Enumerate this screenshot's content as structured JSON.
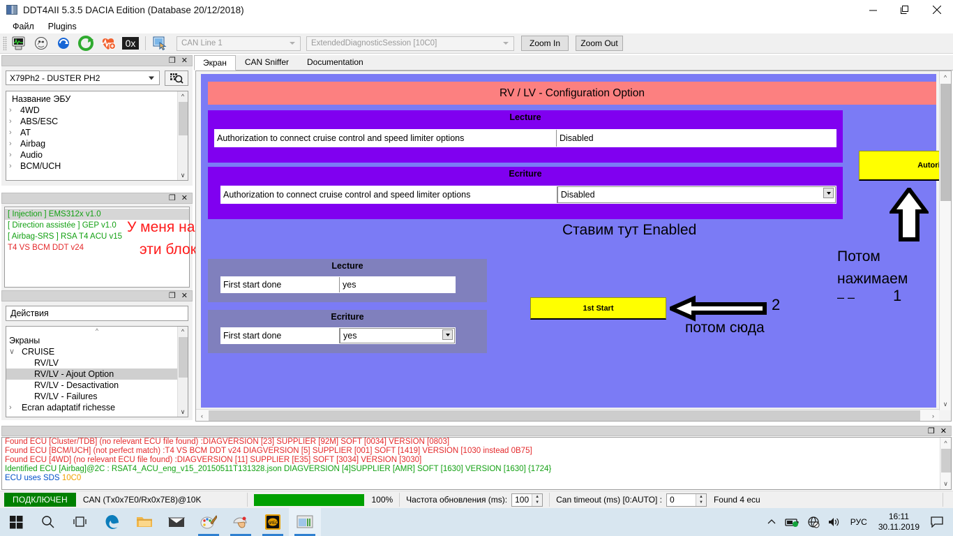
{
  "window": {
    "title": "DDT4AII 5.3.5 DACIA Edition (Database 20/12/2018)",
    "minimize": "minimize-icon",
    "maximize": "maximize-icon",
    "close": "close-icon"
  },
  "menu": {
    "items": [
      "Файл",
      "Plugins"
    ]
  },
  "toolbar": {
    "icons": [
      "scope-icon",
      "ecu-icon",
      "refresh-blue-icon",
      "refresh-green-icon",
      "heartbeat-icon",
      "hex-icon",
      "screen-click-icon"
    ],
    "can_line": "CAN Line 1",
    "session": "ExtendedDiagnosticSession [10C0]",
    "zoom_in": "Zoom In",
    "zoom_out": "Zoom Out"
  },
  "ecu_panel": {
    "vehicle": "X79Ph2 - DUSTER PH2",
    "vin_button": "vin-scan-icon",
    "list_header": "Название ЭБУ",
    "items": [
      "4WD",
      "ABS/ESC",
      "AT",
      "Airbag",
      "Audio",
      "BCM/UCH"
    ]
  },
  "found_panel": {
    "items": [
      {
        "text": "[ Injection ] EMS312x v1.0",
        "color": "green",
        "selected": true
      },
      {
        "text": "[ Direction assistée ] GEP v1.0",
        "color": "green",
        "selected": false
      },
      {
        "text": "[ Airbag-SRS ] RSA T4 ACU v15",
        "color": "green",
        "selected": false
      },
      {
        "text": "T4 VS BCM DDT v24",
        "color": "red",
        "selected": false
      }
    ],
    "annotation_line1": "У меня нашлись",
    "annotation_line2": "эти блоки"
  },
  "actions_panel": {
    "search_value": "Действия",
    "tree": [
      {
        "label": "Экраны",
        "level": 0,
        "chev": "",
        "selected": false
      },
      {
        "label": "CRUISE",
        "level": 1,
        "chev": "expanded",
        "selected": false
      },
      {
        "label": "RV/LV",
        "level": 2,
        "chev": "",
        "selected": false
      },
      {
        "label": "RV/LV - Ajout Option",
        "level": 2,
        "chev": "",
        "selected": true
      },
      {
        "label": "RV/LV - Desactivation",
        "level": 2,
        "chev": "",
        "selected": false
      },
      {
        "label": "RV/LV - Failures",
        "level": 2,
        "chev": "",
        "selected": false
      },
      {
        "label": "Ecran adaptatif richesse",
        "level": 1,
        "chev": "collapsed",
        "selected": false
      }
    ]
  },
  "tabs": [
    {
      "label": "Экран",
      "active": true
    },
    {
      "label": "CAN Sniffer",
      "active": false
    },
    {
      "label": "Documentation",
      "active": false
    }
  ],
  "screen": {
    "title": "RV / LV - Configuration Option",
    "group_lecture_title": "Lecture",
    "group_ecriture_title": "Ecriture",
    "auth_label": "Authorization to connect cruise control and speed limiter options",
    "auth_read_value": "Disabled",
    "auth_write_value": "Disabled",
    "first_start_label": "First start done",
    "first_start_read_value": "yes",
    "first_start_write_value": "yes",
    "autorisation_button": "Autorisation",
    "first_start_button": "1st Start",
    "note_enabled": "Ставим тут Enabled",
    "note_potom": "Потом",
    "note_nazhimaem": "нажимаем",
    "note_dashes": "– –",
    "note_one": "1",
    "note_two": "2",
    "note_potom_syuda": "потом сюда"
  },
  "log": {
    "lines": [
      {
        "text": "Found ECU [Cluster/TDB] (no relevant ECU file found) :DIAGVERSION [23] SUPPLIER [92M] SOFT [0034] VERSION [0803]",
        "color": "red"
      },
      {
        "text": "Found ECU [BCM/UCH] (not perfect match) :T4 VS BCM DDT v24 DIAGVERSION [5] SUPPLIER [001] SOFT [1419] VERSION [1030 instead 0B75]",
        "color": "red"
      },
      {
        "text": "Found ECU [4WD] (no relevant ECU file found) :DIAGVERSION [11] SUPPLIER [E35] SOFT [3034] VERSION [3030]",
        "color": "red"
      },
      {
        "text": "Identified ECU [Airbag]@2C : RSAT4_ACU_eng_v15_20150511T131328.json DIAGVERSION [4]SUPPLIER [AMR] SOFT [1630] VERSION [1630] {1724}",
        "color": "green"
      }
    ],
    "last_line_prefix": "ECU uses SDS",
    "last_line_code": "10C0"
  },
  "status": {
    "connected": "ПОДКЛЮЧЕН",
    "can_info": "CAN (Tx0x7E0/Rx0x7E8)@10K",
    "progress_label": "100%",
    "refresh_label": "Частота обновления (ms):",
    "refresh_value": "100",
    "timeout_label": "Can timeout (ms) [0:AUTO] :",
    "timeout_value": "0",
    "found_label": "Found 4 ecu"
  },
  "taskbar": {
    "items": [
      "start-icon",
      "search-icon",
      "task-view-icon",
      "edge-icon",
      "file-explorer-icon",
      "mail-icon",
      "paint-icon",
      "mouse-tool-icon",
      "ddt4all-icon",
      "app-window-icon"
    ],
    "tray": [
      "show-hidden-icons-icon",
      "battery-icon",
      "network-icon",
      "volume-icon"
    ],
    "language": "РУС",
    "time": "16:11",
    "date": "30.11.2019",
    "notifications": "notifications-icon"
  },
  "colors": {
    "screen_bg": "#7b7bf5",
    "title_bar": "#fc8080",
    "group_purple": "#8000f0",
    "group_gray": "#8080bd",
    "accent_yellow": "#ffff00",
    "connected_green": "#008000",
    "log_red": "#e4292b",
    "log_green": "#12a012"
  }
}
